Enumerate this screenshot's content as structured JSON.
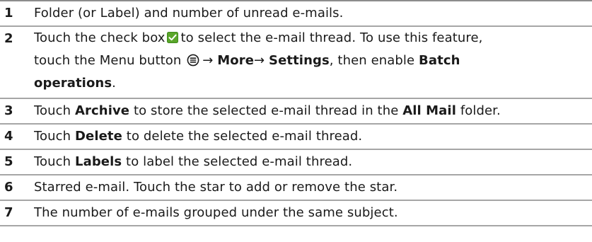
{
  "rows": [
    {
      "num": "1",
      "text": "Folder (or Label) and number of unread e-mails."
    },
    {
      "num": "2",
      "parts": {
        "a": "Touch the check box",
        "b": "to select the e-mail thread. To use this feature,",
        "c": "touch the Menu button",
        "d": "→",
        "e": "More",
        "f": "→",
        "g": "Settings",
        "h": ", then enable",
        "i": "Batch",
        "j": "operations",
        "k": "."
      }
    },
    {
      "num": "3",
      "parts": {
        "a": "Touch",
        "b": "Archive",
        "c": "to store the selected e-mail thread in the",
        "d": "All Mail",
        "e": "folder."
      }
    },
    {
      "num": "4",
      "parts": {
        "a": "Touch",
        "b": "Delete",
        "c": "to delete the selected e-mail thread."
      }
    },
    {
      "num": "5",
      "parts": {
        "a": "Touch",
        "b": "Labels",
        "c": "to label the selected e-mail thread."
      }
    },
    {
      "num": "6",
      "text": "Starred e-mail. Touch the star to add or remove the star."
    },
    {
      "num": "7",
      "text": "The number of e-mails grouped under the same subject."
    }
  ],
  "icons": {
    "checkbox": "checkbox-checked-icon",
    "menu": "menu-button-icon"
  },
  "colors": {
    "checkbox_green": "#5aa62a",
    "rule": "#a6a6a6"
  }
}
